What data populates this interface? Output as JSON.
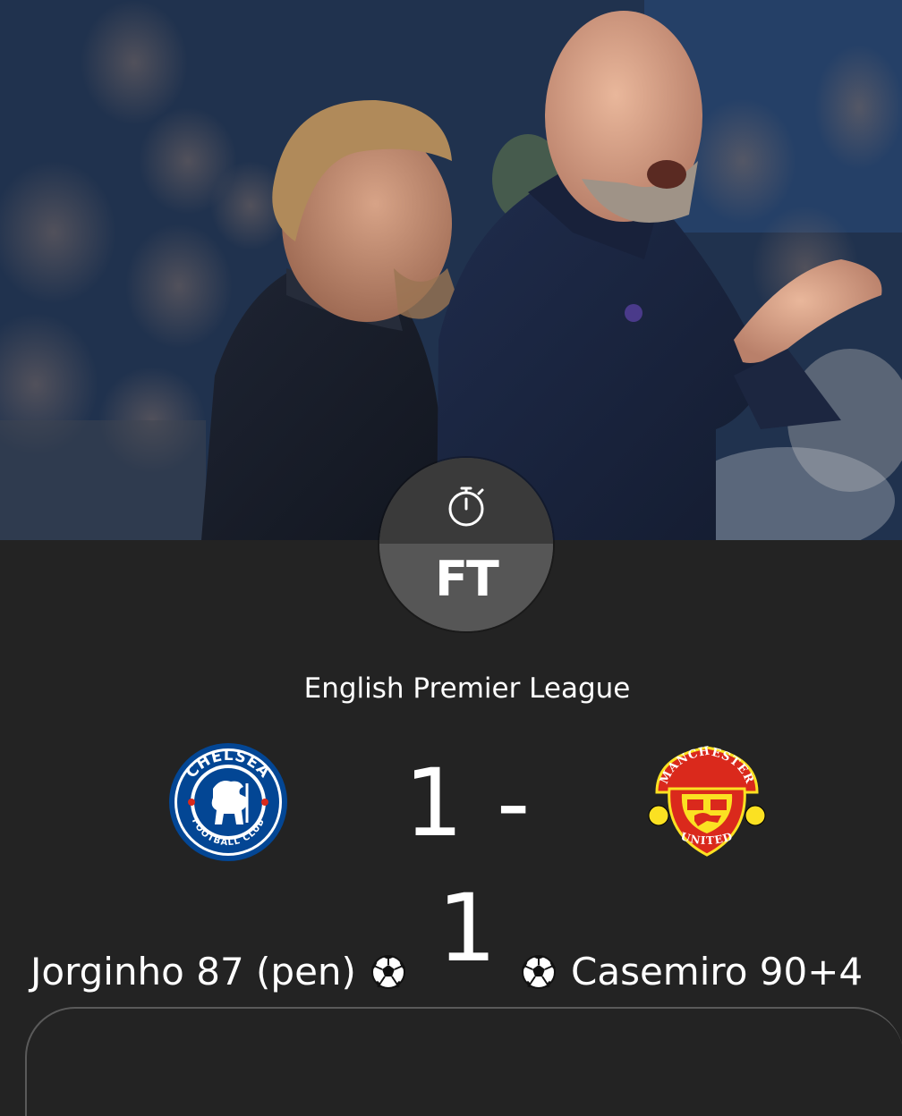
{
  "match": {
    "status": "FT",
    "competition": "English Premier League",
    "score": "1 - 1",
    "home": {
      "team": "Chelsea",
      "crest_top_text": "CHELSEA",
      "crest_bottom_text": "FOOTBALL CLUB",
      "scorer": "Jorginho 87 (pen)"
    },
    "away": {
      "team": "Manchester United",
      "crest_top_text": "MANCHESTER",
      "crest_bottom_text": "UNITED",
      "scorer": "Casemiro 90+4"
    }
  },
  "icons": {
    "status": "stopwatch-icon",
    "goal": "soccer-ball-icon"
  },
  "colors": {
    "background": "#232323",
    "badge_top": "#3a3a3a",
    "badge_bottom": "#565656",
    "chelsea_blue": "#034694",
    "united_red": "#da291c",
    "united_yellow": "#fbe122"
  }
}
